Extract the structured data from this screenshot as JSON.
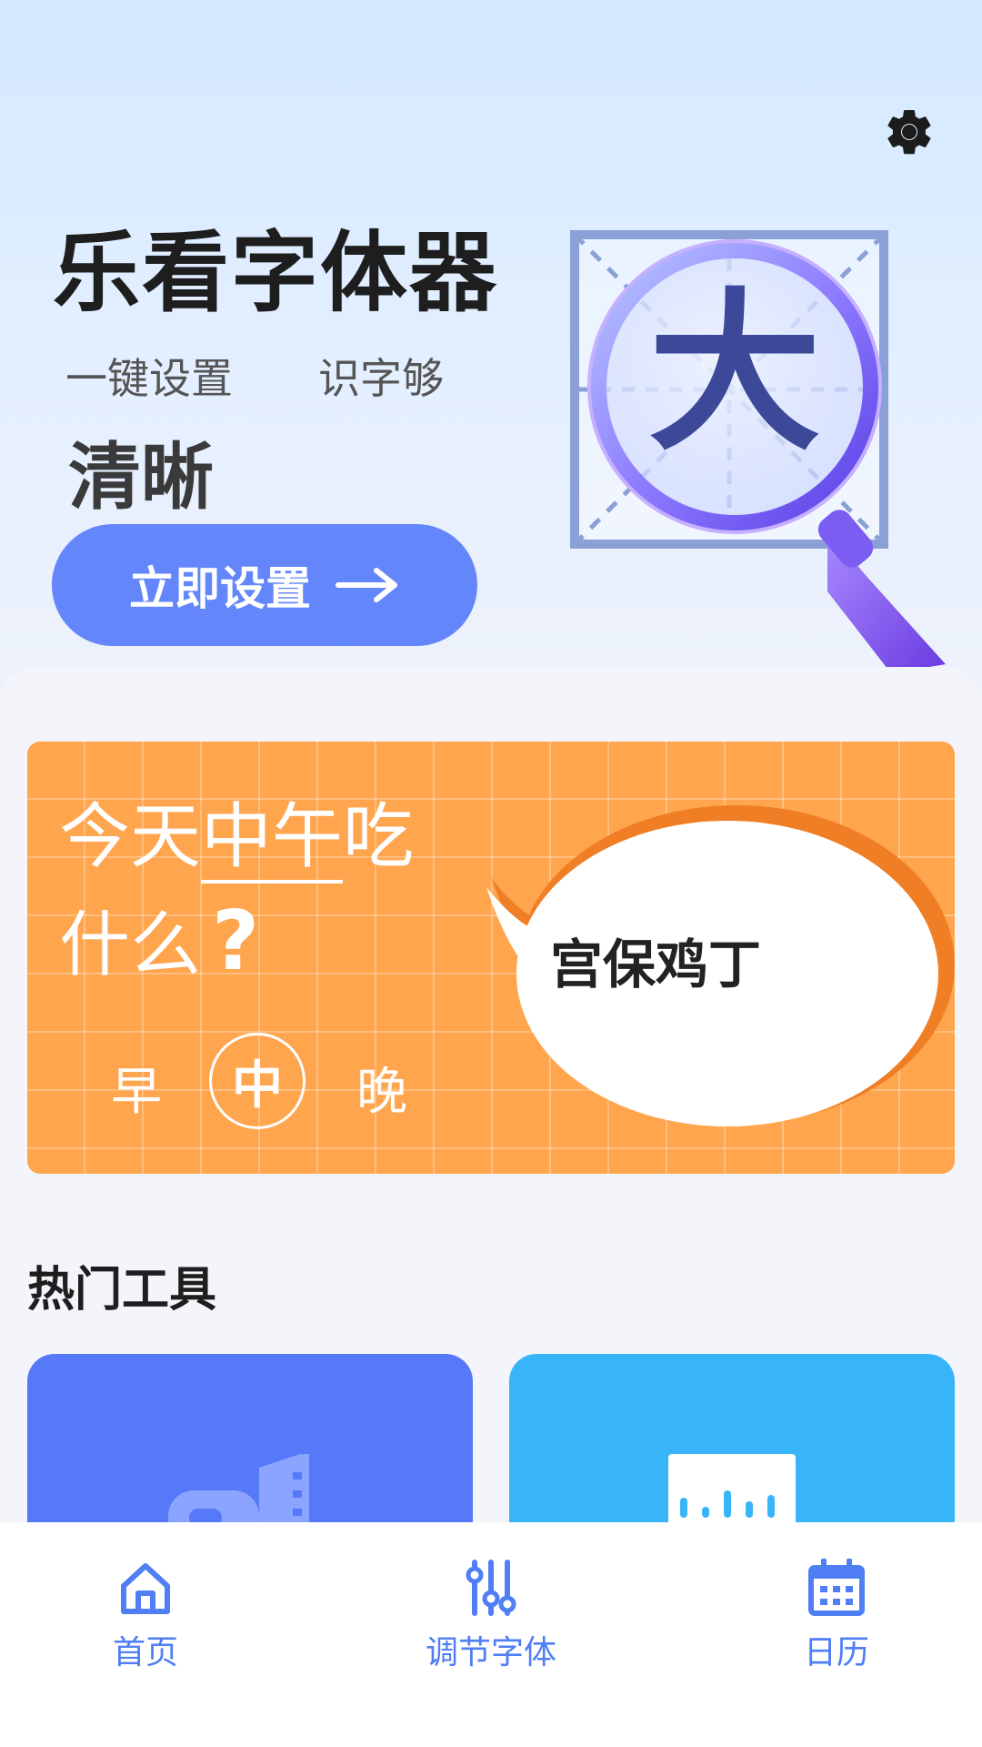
{
  "header": {
    "title": "乐看字体器",
    "subtitle_left": "一键设置",
    "subtitle_right": "识字够",
    "subtitle_bold": "清晰",
    "cta_label": "立即设置",
    "illustration_char": "大"
  },
  "banner": {
    "line1_prefix": "今天",
    "line1_underlined": "中午",
    "line1_suffix": "吃",
    "line2": "什么",
    "question_mark": "?",
    "meals": {
      "morning": "早",
      "noon": "中",
      "evening": "晚"
    },
    "selected_meal": "中",
    "answer": "宫保鸡丁",
    "bg_color": "#ffa54e"
  },
  "hot_tools": {
    "title": "热门工具",
    "cards": [
      {
        "icon": "megaphone-icon",
        "color": "#5579f8"
      },
      {
        "icon": "noise-meter-icon",
        "color": "#38b5f8"
      }
    ]
  },
  "tabbar": {
    "accent": "#4f7ef5",
    "items": [
      {
        "label": "首页",
        "icon": "home-icon"
      },
      {
        "label": "调节字体",
        "icon": "sliders-icon"
      },
      {
        "label": "日历",
        "icon": "calendar-icon"
      }
    ]
  }
}
